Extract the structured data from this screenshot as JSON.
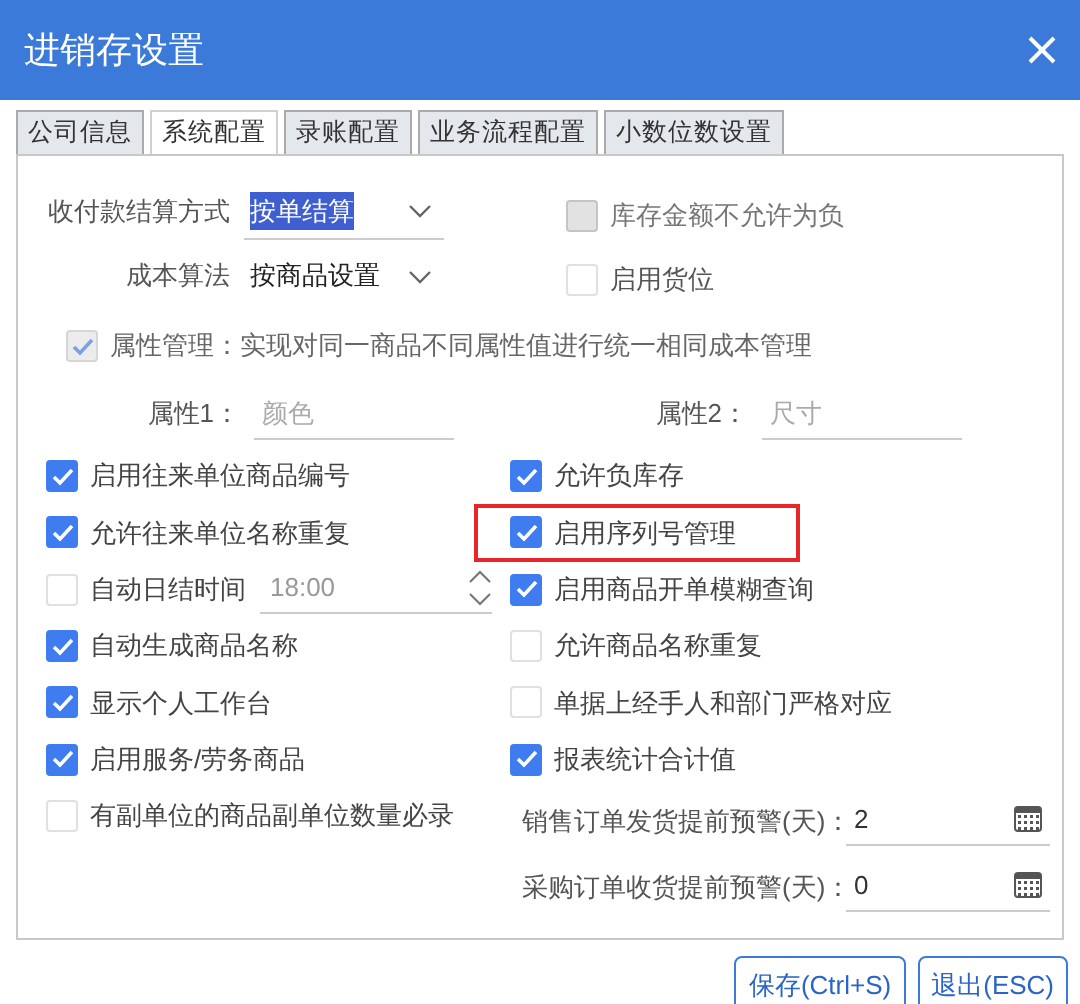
{
  "window": {
    "title": "进销存设置"
  },
  "tabs": [
    {
      "label": "公司信息",
      "selected": false
    },
    {
      "label": "系统配置",
      "selected": true
    },
    {
      "label": "录账配置",
      "selected": false
    },
    {
      "label": "业务流程配置",
      "selected": false
    },
    {
      "label": "小数位数设置",
      "selected": false
    }
  ],
  "settings": {
    "selects": [
      {
        "label": "收付款结算方式",
        "value": "按单结算",
        "text_selected": true
      },
      {
        "label": "成本算法",
        "value": "按商品设置",
        "text_selected": false
      }
    ],
    "top_options": [
      {
        "label": "库存金额不允许为负",
        "checked": false,
        "disabled": true
      },
      {
        "label": "启用货位",
        "checked": false,
        "disabled": false
      }
    ],
    "attribute_management": {
      "label": "属性管理：实现对同一商品不同属性值进行统一相同成本管理",
      "checked": true,
      "disabled": true
    },
    "attributes": [
      {
        "label": "属性1：",
        "placeholder": "颜色"
      },
      {
        "label": "属性2：",
        "placeholder": "尺寸"
      }
    ],
    "left_options": [
      {
        "kind": "checkbox",
        "label": "启用往来单位商品编号",
        "checked": true
      },
      {
        "kind": "checkbox",
        "label": "允许往来单位名称重复",
        "checked": true
      },
      {
        "kind": "time",
        "label": "自动日结时间",
        "checked": false,
        "value": "18:00",
        "disabled": true
      },
      {
        "kind": "checkbox",
        "label": "自动生成商品名称",
        "checked": true
      },
      {
        "kind": "checkbox",
        "label": "显示个人工作台",
        "checked": true
      },
      {
        "kind": "checkbox",
        "label": "启用服务/劳务商品",
        "checked": true
      },
      {
        "kind": "checkbox",
        "label": "有副单位的商品副单位数量必录",
        "checked": false
      }
    ],
    "right_options": [
      {
        "label": "允许负库存",
        "checked": true,
        "annotated": false
      },
      {
        "label": "启用序列号管理",
        "checked": true,
        "annotated": true
      },
      {
        "label": "启用商品开单模糊查询",
        "checked": true,
        "annotated": false
      },
      {
        "label": "允许商品名称重复",
        "checked": false,
        "annotated": false
      },
      {
        "label": "单据上经手人和部门严格对应",
        "checked": false,
        "annotated": false
      },
      {
        "label": "报表统计合计值",
        "checked": true,
        "annotated": false
      }
    ],
    "warnings": [
      {
        "label": "销售订单发货提前预警(天)：",
        "value": "2"
      },
      {
        "label": "采购订单收货提前预警(天)：",
        "value": "0"
      }
    ]
  },
  "buttons": [
    "保存(Ctrl+S)",
    "退出(ESC)"
  ]
}
